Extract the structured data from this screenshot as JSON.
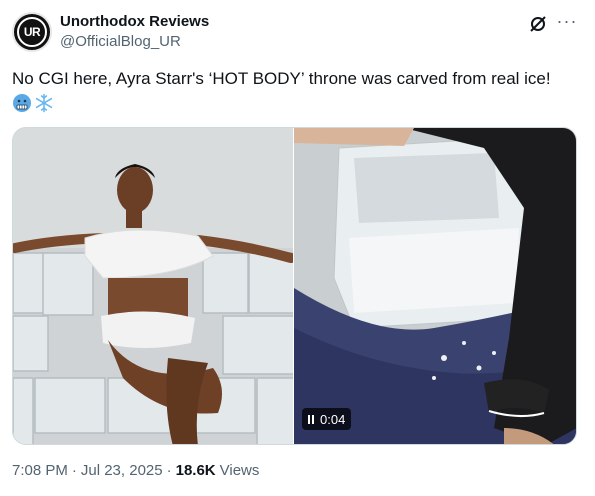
{
  "author": {
    "avatar_text": "UR",
    "display_name": "Unorthodox Reviews",
    "handle": "@OfficialBlog_UR"
  },
  "tweet": {
    "text": "No CGI here, Ayra Starr's ‘HOT BODY’ throne was carved from real ice!",
    "emojis": [
      "cold-face-emoji",
      "snowflake-emoji"
    ]
  },
  "media": {
    "video_duration": "0:04"
  },
  "meta": {
    "time": "7:08 PM",
    "separator": "·",
    "date": "Jul 23, 2025",
    "views_count": "18.6K",
    "views_label": "Views"
  },
  "icons": {
    "grok": "grok-icon",
    "more": "more-icon"
  }
}
